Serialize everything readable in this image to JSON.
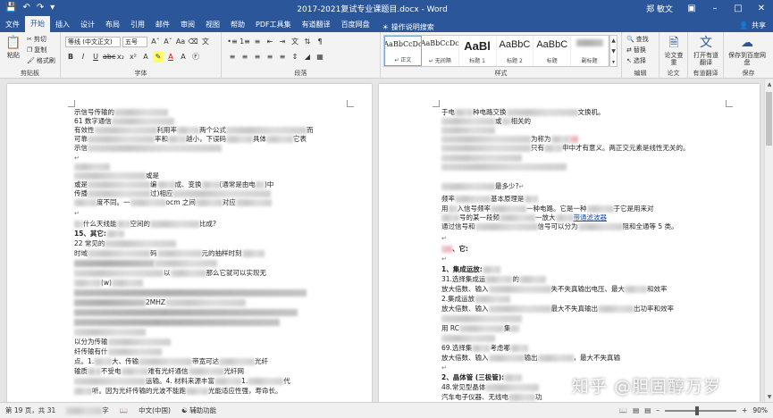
{
  "titlebar": {
    "title": "2017-2021复试专业课题目.docx - Word",
    "user": "郑 敏文",
    "qat": [
      "save-icon",
      "undo-icon",
      "redo-icon",
      "customize-icon"
    ],
    "controls": [
      "ribbon-display-icon",
      "minimize-icon",
      "maximize-icon",
      "close-icon"
    ]
  },
  "tabs": {
    "items": [
      "文件",
      "开始",
      "插入",
      "设计",
      "布局",
      "引用",
      "邮件",
      "审阅",
      "视图",
      "帮助",
      "PDF工具集",
      "有道翻译",
      "百度网盘"
    ],
    "active": "开始",
    "tell_me": "操作说明搜索",
    "share": "共享"
  },
  "ribbon": {
    "clipboard": {
      "paste": "粘贴",
      "cut": "剪切",
      "copy": "复制",
      "format_painter": "格式刷",
      "label": "剪贴板"
    },
    "font": {
      "font_name": "等线 (中文正文)",
      "font_size": "五号",
      "label": "字体"
    },
    "paragraph": {
      "label": "段落"
    },
    "styles": {
      "items": [
        {
          "sample": "AaBbCcDc",
          "name": "↵ 正文"
        },
        {
          "sample": "AaBbCcDc",
          "name": "↵ 无间隔"
        },
        {
          "sample": "AaBl",
          "name": "标题 1"
        },
        {
          "sample": "AaBbC",
          "name": "标题 2"
        },
        {
          "sample": "AaBbC",
          "name": "标题"
        },
        {
          "sample": "",
          "name": "副标题"
        }
      ],
      "label": "样式"
    },
    "editing": {
      "find": "查找",
      "replace": "替换",
      "select": "选择",
      "label": "编辑"
    },
    "paper_check": {
      "button": "论文查重",
      "label": "论文"
    },
    "youdao": {
      "button": "打开有道翻译",
      "label": "有道翻译"
    },
    "save": {
      "button": "保存到百度网盘",
      "label": "保存"
    }
  },
  "doc": {
    "left": {
      "line1": "示信号传输的",
      "line2": "61 数字通信",
      "line3a": "有效性",
      "line3b": "利用率",
      "line3c": "两个公式",
      "line3d": "而",
      "line4a": "可靠",
      "line4b": "率和",
      "line4c": "越小，下误码",
      "line4d": "具体",
      "line4e": "它表",
      "line5": "示信",
      "line6a": "或是",
      "line7a": "或是",
      "line7b": "编",
      "line7c": "成、变换",
      "line7d": "(通常是由电",
      "line7e": ")中",
      "line8a": "传播",
      "line8b": "过)相应",
      "line9a": "度不同。一",
      "line9b": "ocm 之间",
      "line9c": "对应",
      "line10a": "什么天线能",
      "line10b": "空间的",
      "line10c": "比成?",
      "line11": "15、其它:",
      "line12": "22 常见的",
      "line13a": "时域",
      "line13b": "码",
      "line13c": "元的抽样时刻",
      "line14a": "以",
      "line14b": "那么它就可以实现无",
      "line15": "(w)",
      "line16a": "2MHZ",
      "line17a": "以分为传输",
      "line18": "纤传输有什",
      "line19a": "点。1.",
      "line19b": "大、传输",
      "line19c": "带宽可达",
      "line19d": "光纤",
      "line20a": "输质",
      "line20b": "不受电",
      "line20c": "难有光纤通信",
      "line20d": "光纤网",
      "line21a": "运输。4. 材料来源丰富",
      "line21b": "1.",
      "line21c": "代",
      "line22a": "听。因为光纤传输的光波不能跑",
      "line22b": "光能适应性强，寿命长。"
    },
    "right": {
      "line1a": "于电",
      "line1b": "种电路交换",
      "line1c": "文换机。",
      "line2a": "或",
      "line2b": "相关的",
      "line3a": "为称为",
      "line4a": "只有",
      "line4b": "申中才有意义。两正交元素是线性无关的。",
      "line5a": "最多少?",
      "line6a": "频率",
      "line6b": "基本原理是",
      "line7a": "用",
      "line7b": "入信号频率",
      "line7c": "一种电路。它是一种",
      "line7d": "于它是用来对",
      "line8a": "号的某一段频",
      "line8b": "一放大",
      "line8c": "带通滤波器",
      "line9a": "通过信号和",
      "line9b": "信号可以分为",
      "line9c": "阻和全通等 5 类。",
      "line10": "、它:",
      "line11": "1、集成运放:",
      "line12a": "31.选择集成运",
      "line12b": "的",
      "line13a": "放大倍数、输入",
      "line13b": "失不失真输出电压、最大",
      "line13c": "和效率",
      "line14a": "2.集成运放",
      "line15a": "放大倍数、输入",
      "line15b": "最大不失真输出",
      "line15c": "出功率和效率",
      "line16a": "用 RC",
      "line16b": "集",
      "line17a": "69.选择集",
      "line17b": "考虑哪",
      "line18a": "放大倍数、输入",
      "line18b": "输出",
      "line18c": "，最大不失真输",
      "line19": "2、晶体管 (三极管):",
      "line20a": "48.常见型晶体",
      "line21a": "汽车电子仪器、无线电",
      "line21b": "功"
    }
  },
  "status": {
    "page": "第 19 页，共 31",
    "chars": "字",
    "lang": "中文(中国)",
    "accessibility": "辅助功能",
    "zoom": "90%",
    "zoom_level": 0.9
  },
  "watermark": "知乎 @胆固醇万岁"
}
